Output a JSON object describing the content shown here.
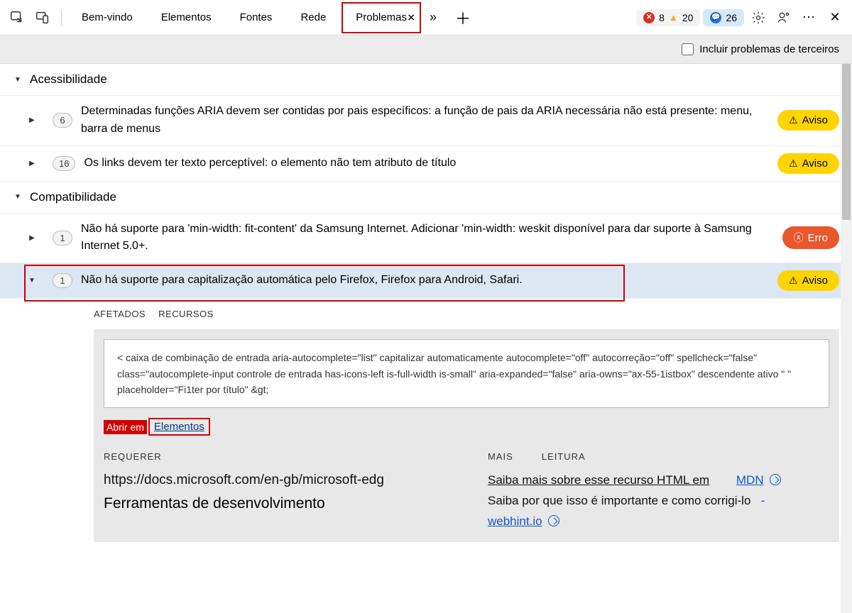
{
  "toolbar": {
    "tabs": [
      "Bem-vindo",
      "Elementos",
      "Fontes",
      "Rede",
      "Problemas"
    ],
    "active_tab_index": 4,
    "counts": {
      "errors": "8",
      "warnings": "20",
      "messages": "26"
    }
  },
  "subbar": {
    "include_third_party_label": "Incluir problemas de terceiros",
    "include_third_party_checked": false
  },
  "categories": [
    {
      "name": "Acessibilidade",
      "expanded": true,
      "issues": [
        {
          "count": "6",
          "expanded": false,
          "text": "Determinadas funções ARIA devem ser contidas por pais específicos: a função de pais da ARIA necessária não está presente: menu, barra de menus",
          "severity": "warn",
          "severity_label": "Aviso"
        },
        {
          "count": "16",
          "expanded": false,
          "text": "Os links devem ter texto perceptível: o elemento não tem atributo de título",
          "severity": "warn",
          "severity_label": "Aviso"
        }
      ]
    },
    {
      "name": "Compatibilidade",
      "expanded": true,
      "issues": [
        {
          "count": "1",
          "expanded": false,
          "text": "Não há suporte para 'min-width: fit-content' da Samsung Internet. Adicionar 'min-width: weskit disponível para dar suporte à Samsung Internet 5.0+.",
          "severity": "err",
          "severity_label": "Erro"
        },
        {
          "count": "1",
          "expanded": true,
          "selected": true,
          "text": "Não há suporte para capitalização automática pelo Firefox, Firefox para Android, Safari.",
          "severity": "warn",
          "severity_label": "Aviso"
        }
      ]
    }
  ],
  "detail": {
    "tabs": [
      "AFETADOS",
      "RECURSOS"
    ],
    "code": "< caixa de combinação de entrada aria-autocomplete=\"list\" capitalizar automaticamente autocomplete=\"off\" autocorreção=\"off\" spellcheck=\"false\" class=\"autocomplete-input controle de entrada has-icons-left is-full-width is-small\" aria-expanded=\"false\" aria-owns=\"ax-55-1istbox\" descendente ativo                               \" \"    placeholder=\"Fi1ter por título\" &gt;",
    "open_in_label": "Abrir em",
    "open_in_target": "Elementos",
    "left": {
      "head": "REQUERER",
      "link": "https://docs.microsoft.com/en-gb/microsoft-edg",
      "subtitle": "Ferramentas de desenvolvimento"
    },
    "right": {
      "head_a": "MAIS",
      "head_b": "LEITURA",
      "line1_a": "Saiba mais sobre esse recurso HTML em",
      "line1_link": "MDN",
      "line2_a": "Saiba por que isso é importante e como corrigi-lo",
      "line2_link": "webhint.io"
    }
  }
}
